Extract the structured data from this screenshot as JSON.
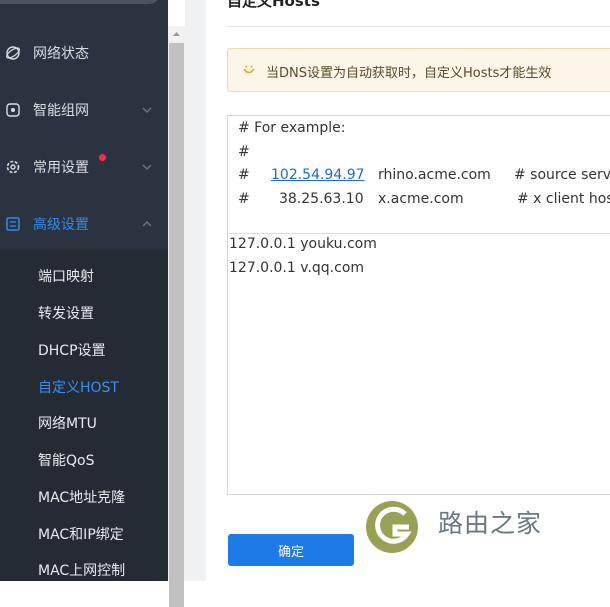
{
  "sidebar": {
    "items": [
      {
        "label": "网络状态",
        "icon": "globe-icon"
      },
      {
        "label": "智能组网",
        "icon": "network-icon"
      },
      {
        "label": "常用设置",
        "icon": "gear-icon"
      },
      {
        "label": "高级设置",
        "icon": "advanced-settings-icon"
      }
    ],
    "subitems": [
      "端口映射",
      "转发设置",
      "DHCP设置",
      "自定义HOST",
      "网络MTU",
      "智能QoS",
      "MAC地址克隆",
      "MAC和IP绑定",
      "MAC上网控制"
    ],
    "active_subitem": "自定义HOST",
    "active_color": "#2e8bf0",
    "badge_color": "#ff2a4a"
  },
  "page": {
    "title": "自定义Hosts",
    "notice": "当DNS设置为自动获取时，自定义Hosts才能生效",
    "notice_icon": "smile-icon",
    "example": {
      "heading": "# For example:",
      "blank": "#",
      "row1": {
        "hash": "#",
        "ip": "102.54.94.97",
        "host": "rhino.acme.com",
        "comment": "# source server"
      },
      "row2": {
        "hash": "#",
        "ip": "38.25.63.10",
        "host": "x.acme.com",
        "comment": "# x client host"
      }
    },
    "hosts_lines": [
      "127.0.0.1 youku.com",
      "127.0.0.1 v.qq.com"
    ],
    "confirm_label": "确定"
  },
  "watermark": {
    "text": "路由之家"
  }
}
